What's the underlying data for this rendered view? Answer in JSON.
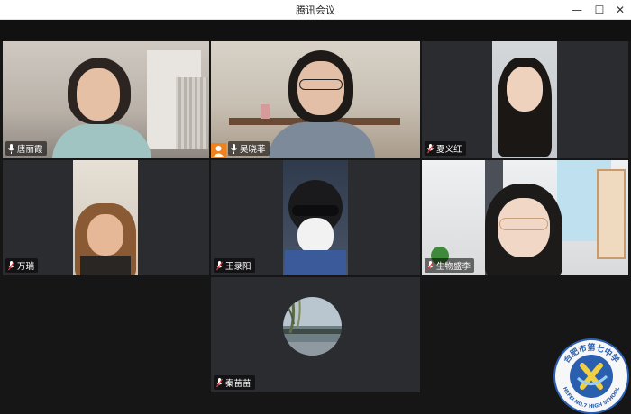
{
  "window": {
    "title": "腾讯会议",
    "minimize": "—",
    "maximize": "☐",
    "close": "✕"
  },
  "participants": [
    {
      "name": "唐丽霞"
    },
    {
      "name": "吴晓菲"
    },
    {
      "name": "夏义红"
    },
    {
      "name": "万瑞"
    },
    {
      "name": "王录阳"
    },
    {
      "name": "生物盛李"
    },
    {
      "name": "秦苗苗"
    }
  ],
  "watermark": {
    "text_top": "合肥市第七中学",
    "text_bottom": "HEFEI NO.7 HIGH SCHOOL"
  }
}
